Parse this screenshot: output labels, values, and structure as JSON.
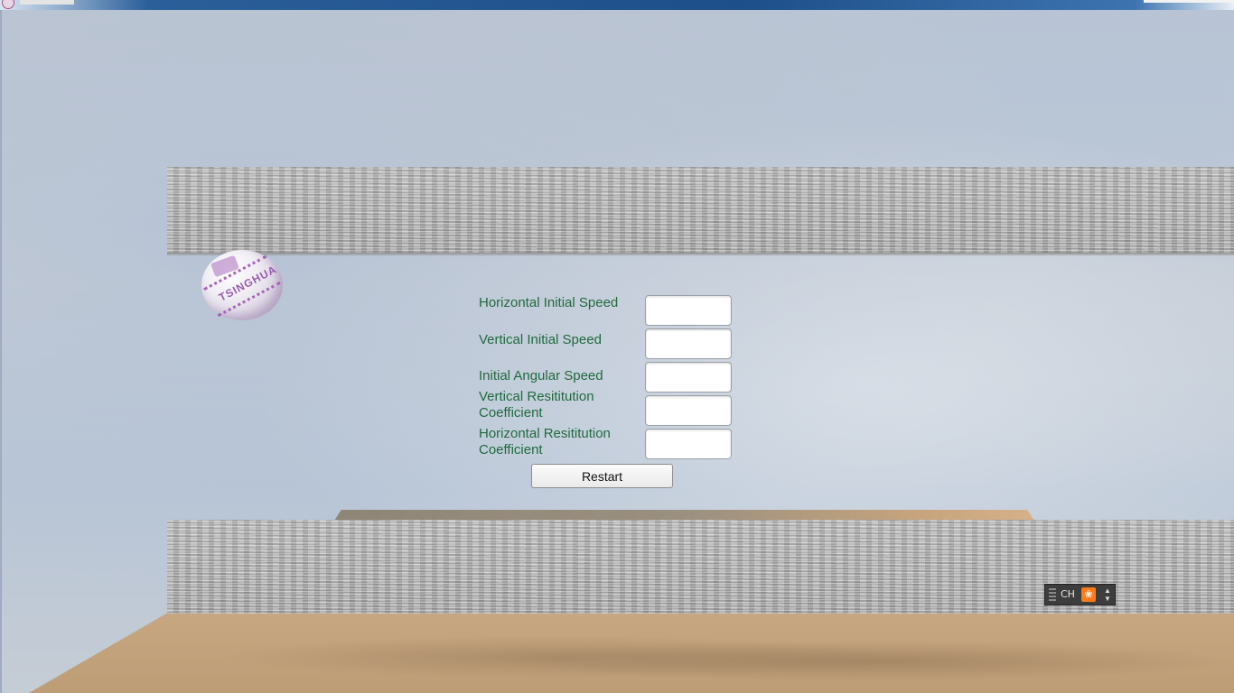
{
  "window": {
    "title": ""
  },
  "scene": {
    "ball_text": "TSINGHUA"
  },
  "form": {
    "fields": [
      {
        "label": "Horizontal Initial Speed",
        "value": ""
      },
      {
        "label": "Vertical Initial Speed",
        "value": ""
      },
      {
        "label": "Initial Angular Speed",
        "value": ""
      },
      {
        "label": "Vertical Resititution Coefficient",
        "value": ""
      },
      {
        "label": "Horizontal Resititution Coefficient",
        "value": ""
      }
    ],
    "restart_label": "Restart"
  },
  "ime": {
    "language": "CH",
    "icon": "paw-icon"
  },
  "colors": {
    "label_text": "#1f6a3c",
    "ime_accent": "#ff7a1a"
  }
}
